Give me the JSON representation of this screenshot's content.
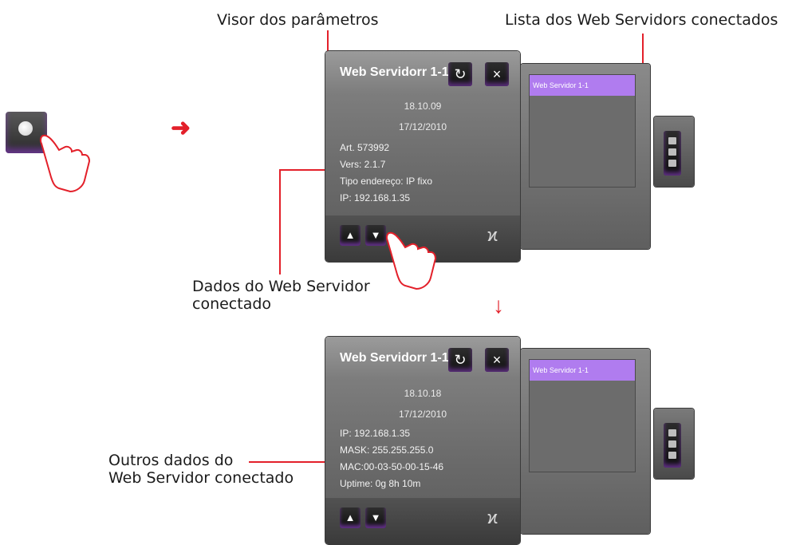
{
  "annotations": {
    "param_viewer": "Visor dos parâmetros",
    "server_list": "Lista dos Web Servidors conectados",
    "server_data_line1": "Dados do Web Servidor",
    "server_data_line2": "conectado",
    "other_data_line1": "Outros dados do",
    "other_data_line2": "Web Servidor conectado"
  },
  "panel_top": {
    "title": "Web Servidorr 1-1",
    "time": "18.10.09",
    "date": "17/12/2010",
    "lines": [
      "Art. 573992",
      "Vers: 2.1.7",
      "Tipo endereço: IP fixo",
      "IP: 192.168.1.35"
    ]
  },
  "panel_bottom": {
    "title": "Web Servidorr 1-1",
    "time": "18.10.18",
    "date": "17/12/2010",
    "lines": [
      "IP: 192.168.1.35",
      "MASK: 255.255.255.0",
      "MAC:00-03-50-00-15-46",
      "Uptime: 0g 8h 10m"
    ]
  },
  "server_list": {
    "selected": "Web Servidor 1-1"
  },
  "icons": {
    "refresh": "↻",
    "close": "×",
    "up": "▲",
    "down": "▼",
    "connection": "ϰ"
  },
  "colors": {
    "accent_red": "#e3202a",
    "selection": "#b07cef"
  }
}
